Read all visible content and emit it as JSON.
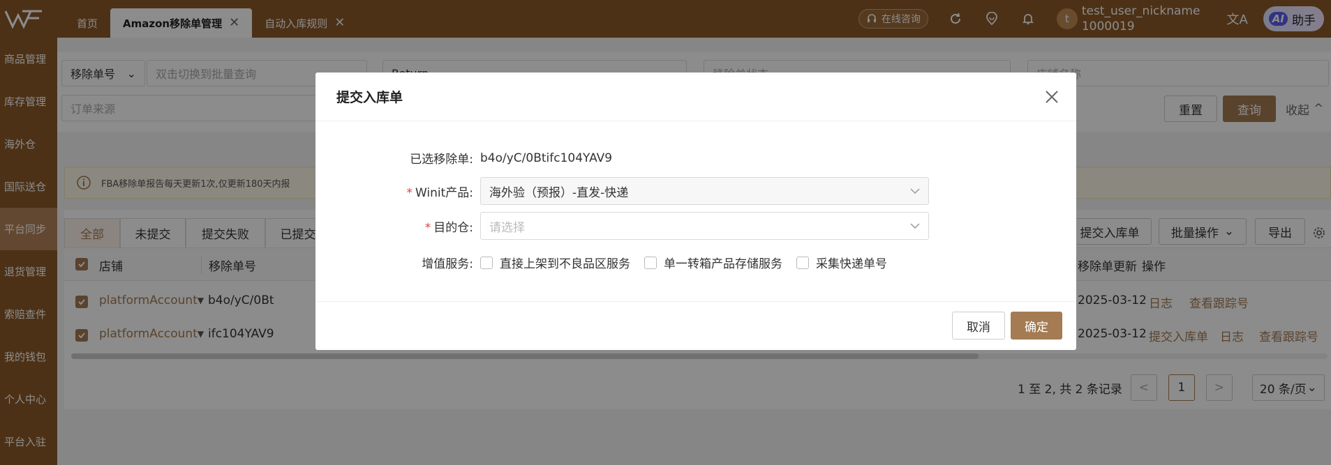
{
  "header": {
    "tabs": [
      {
        "label": "首页",
        "closable": false
      },
      {
        "label": "Amazon移除单管理",
        "closable": true,
        "active": true
      },
      {
        "label": "自动入库规则",
        "closable": true
      }
    ],
    "consult_label": "在线咨询",
    "avatar_letter": "t",
    "nickname_line1": "test_user_nickname",
    "nickname_line2": "1000019",
    "lang_glyph": "文A",
    "ai_badge": "AI",
    "ai_label": "助手"
  },
  "sidebar": {
    "items": [
      {
        "label": "商品管理"
      },
      {
        "label": "库存管理"
      },
      {
        "label": "海外仓"
      },
      {
        "label": "国际送仓"
      },
      {
        "label": "平台同步",
        "active": true
      },
      {
        "label": "退货管理"
      },
      {
        "label": "索赔查件"
      },
      {
        "label": "我的钱包"
      },
      {
        "label": "个人中心"
      },
      {
        "label": "平台入驻"
      }
    ]
  },
  "filters": {
    "field_select": "移除单号",
    "batch_placeholder": "双击切换到批量查询",
    "return_type": "Return",
    "status_placeholder": "移除单状态",
    "store_placeholder": "店铺名称",
    "source_placeholder": "订单来源",
    "reset_label": "重置",
    "query_label": "查询",
    "collapse_label": "收起"
  },
  "notice": {
    "text": "FBA移除单报告每天更新1次,仅更新180天内报"
  },
  "table": {
    "subtabs": [
      "全部",
      "未提交",
      "提交失败",
      "已提交"
    ],
    "submit_inbound_label": "提交入库单",
    "batch_ops_label": "批量操作",
    "export_label": "导出",
    "columns": {
      "store": "店铺",
      "removal_no": "移除单号",
      "updated": "移除单更新",
      "ops": "操作"
    },
    "rows": [
      {
        "store": "platformAccount",
        "removal_no": "b4o/yC/0Bt",
        "updated": "2025-03-12",
        "ops": [
          "日志",
          "查看跟踪号"
        ]
      },
      {
        "store": "platformAccount",
        "removal_no": "ifc104YAV9",
        "updated": "2025-03-12",
        "ops": [
          "提交入库单",
          "日志",
          "查看跟踪号"
        ]
      }
    ]
  },
  "pager": {
    "summary": "1 至 2,  共 2 条记录",
    "prev": "<",
    "current": "1",
    "next": ">",
    "page_size": "20 条/页"
  },
  "modal": {
    "title": "提交入库单",
    "selected_label": "已选移除单:",
    "selected_value": "b4o/yC/0Btifc104YAV9",
    "product_label": "Winit产品:",
    "product_value": "海外验（预报）-直发-快递",
    "warehouse_label": "目的仓:",
    "warehouse_placeholder": "请选择",
    "service_label": "增值服务:",
    "services": [
      "直接上架到不良品区服务",
      "单一转箱产品存储服务",
      "采集快递单号"
    ],
    "required_mark": "*",
    "cancel_label": "取消",
    "confirm_label": "确定"
  },
  "colors": {
    "brand": "#8b5a2b",
    "accent": "#a47b52",
    "required": "#e04040"
  }
}
